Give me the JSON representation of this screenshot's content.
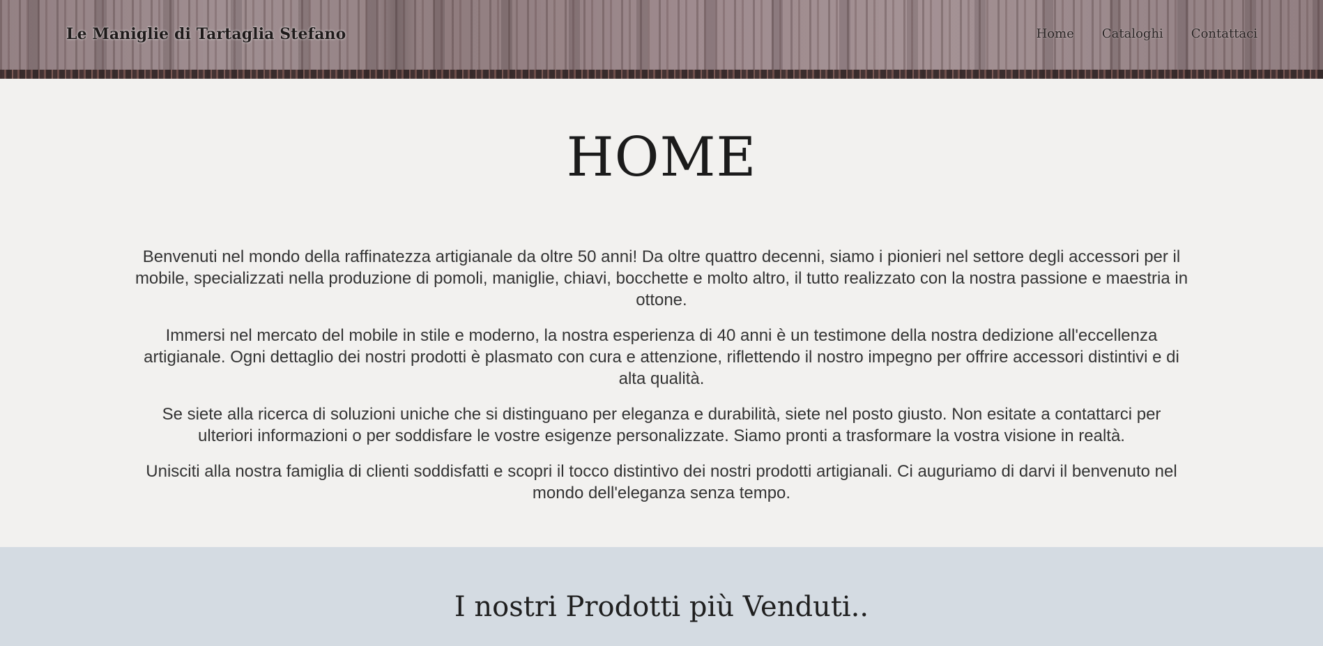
{
  "header": {
    "brand": "Le Maniglie di Tartaglia Stefano",
    "nav": [
      {
        "label": "Home"
      },
      {
        "label": "Cataloghi"
      },
      {
        "label": "Contattaci"
      }
    ]
  },
  "intro": {
    "title": "HOME",
    "paragraphs": [
      "Benvenuti nel mondo della raffinatezza artigianale da oltre 50 anni! Da oltre quattro decenni, siamo i pionieri nel settore degli accessori per il mobile, specializzati nella produzione di pomoli, maniglie, chiavi, bocchette e molto altro, il tutto realizzato con la nostra passione e maestria in ottone.",
      "Immersi nel mercato del mobile in stile e moderno, la nostra esperienza di 40 anni è un testimone della nostra dedizione all'eccellenza artigianale. Ogni dettaglio dei nostri prodotti è plasmato con cura e attenzione, riflettendo il nostro impegno per offrire accessori distintivi e di alta qualità.",
      "Se siete alla ricerca di soluzioni uniche che si distinguano per eleganza e durabilità, siete nel posto giusto. Non esitate a contattarci per ulteriori informazioni o per soddisfare le vostre esigenze personalizzate. Siamo pronti a trasformare la vostra visione in realtà.",
      "Unisciti alla nostra famiglia di clienti soddisfatti e scopri il tocco distintivo dei nostri prodotti artigianali. Ci auguriamo di darvi il benvenuto nel mondo dell'eleganza senza tempo."
    ]
  },
  "bestsellers": {
    "title": "I nostri Prodotti più Venduti.."
  },
  "colors": {
    "page_background": "#f2f1ef",
    "bestsellers_background": "#d4dbe2",
    "text": "#333333"
  }
}
